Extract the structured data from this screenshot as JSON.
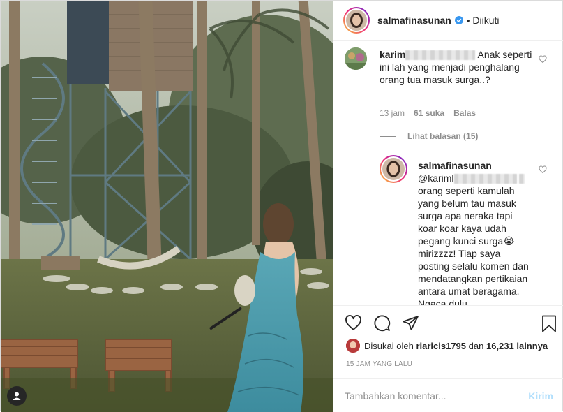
{
  "post": {
    "username": "salmafinasunan",
    "separator": "•",
    "follow_status": "Diikuti",
    "icons": {
      "verified": "verified-badge-icon",
      "tag": "user-tag-icon"
    }
  },
  "comment": {
    "username_prefix": "karim",
    "text": "Anak seperti ini lah yang menjadi penghalang orang tua masuk surga..?",
    "time": "13 jam",
    "likes": "61 suka",
    "reply_label": "Balas"
  },
  "view_replies": "Lihat balasan (15)",
  "reply": {
    "username": "salmafinasunan",
    "mention_prefix": "@kariml",
    "text": "orang seperti kamulah yang belum tau masuk surga apa neraka tapi koar koar kaya udah pegang kunci surga😭 mirizzzz! Tiap saya posting selalu komen dan mendatangkan pertikaian antara umat beragama. Ngaca dulu"
  },
  "actions": {
    "like_icon": "heart-icon",
    "comment_icon": "comment-icon",
    "share_icon": "share-icon",
    "save_icon": "bookmark-icon"
  },
  "liked_by": {
    "prefix": "Disukai oleh",
    "user": "riaricis1795",
    "connector": "dan",
    "count": "16,231 lainnya"
  },
  "time_ago": "15 JAM YANG LALU",
  "add_comment": {
    "placeholder": "Tambahkan komentar...",
    "post_label": "Kirim"
  },
  "colors": {
    "verified": "#3897f0",
    "border": "#dbdbdb",
    "secondary_text": "#8e8e8e",
    "post_button_disabled": "#b2dffc"
  }
}
